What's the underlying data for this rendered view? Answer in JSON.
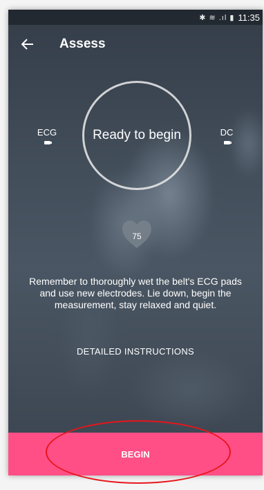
{
  "status_bar": {
    "icons": "✱ ≋ .ıl ▮",
    "time": "11:35"
  },
  "header": {
    "title": "Assess"
  },
  "ring": {
    "label": "Ready to begin"
  },
  "sensors": {
    "left_label": "ECG",
    "right_label": "DC"
  },
  "heart_rate": {
    "value": "75"
  },
  "message": "Remember to thoroughly wet the belt's ECG pads and use new electrodes. Lie down, begin the measurement, stay relaxed and quiet.",
  "detailed_link": "DETAILED INSTRUCTIONS",
  "begin_button": "BEGIN",
  "colors": {
    "accent": "#ff4f86",
    "annotation": "#e8141b"
  },
  "icons": {
    "back": "arrow-left-icon",
    "heart": "heart-icon",
    "battery": "battery-icon"
  }
}
